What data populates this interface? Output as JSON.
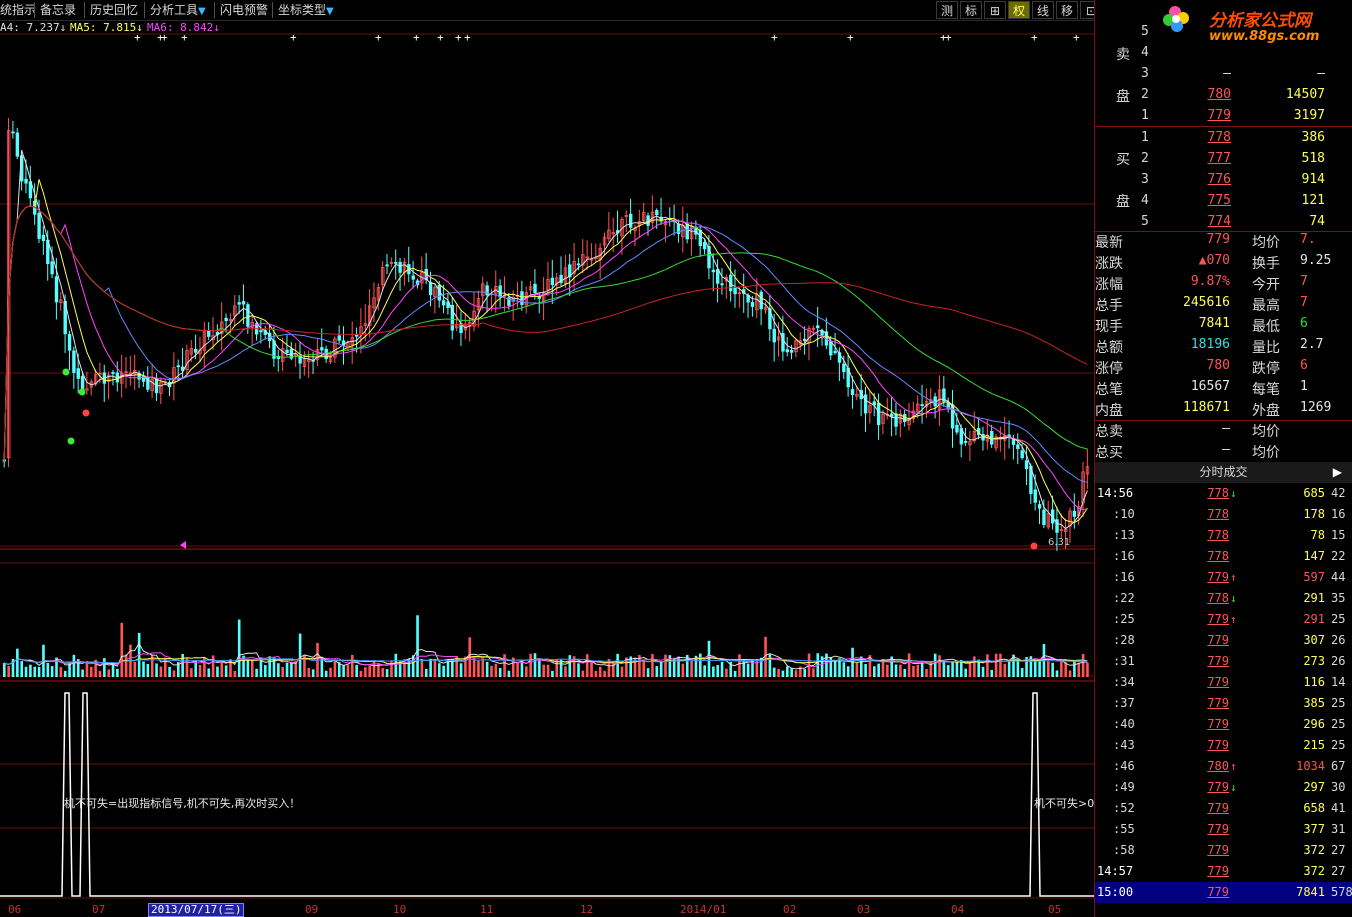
{
  "toolbar": {
    "items": [
      "统指示",
      "备忘录",
      "历史回忆",
      "分析工具",
      "闪电预警",
      "坐标类型"
    ],
    "right_buttons": [
      "测",
      "标",
      "⊞",
      "权",
      "线",
      "移",
      "⊡",
      "⊠"
    ]
  },
  "ma_legend": {
    "ma4": "A4: 7.237↓",
    "ma5": "MA5: 7.815↓",
    "ma6": "MA6: 8.842↓"
  },
  "chart_notes": {
    "low_marker": "6.31",
    "signal_text_left": "机不可失=出现指标信号,机不可失,再次时买入！",
    "signal_text_right": "机不可失>0"
  },
  "x_axis": {
    "labels": [
      "06",
      "07",
      "09",
      "10",
      "11",
      "12",
      "2014/01",
      "02",
      "03",
      "04",
      "05"
    ],
    "selected_date": "2013/07/17(三)"
  },
  "logo": {
    "text": "分析家公式网",
    "url_text": "www.88gs.com"
  },
  "orderbook": {
    "sell_label_1": "卖",
    "sell_label_2": "盘",
    "buy_label_1": "买",
    "buy_label_2": "盘",
    "sell": [
      {
        "level": "5",
        "price": "",
        "volume": ""
      },
      {
        "level": "4",
        "price": "",
        "volume": ""
      },
      {
        "level": "3",
        "price": "–",
        "volume": "–"
      },
      {
        "level": "2",
        "price": "780",
        "volume": "14507"
      },
      {
        "level": "1",
        "price": "779",
        "volume": "3197"
      }
    ],
    "buy": [
      {
        "level": "1",
        "price": "778",
        "volume": "386"
      },
      {
        "level": "2",
        "price": "777",
        "volume": "518"
      },
      {
        "level": "3",
        "price": "776",
        "volume": "914"
      },
      {
        "level": "4",
        "price": "775",
        "volume": "121"
      },
      {
        "level": "5",
        "price": "774",
        "volume": "74"
      }
    ]
  },
  "stats": [
    {
      "l": "最新",
      "v": "779",
      "vc": "red",
      "r": "均价",
      "rv": "7."
    },
    {
      "l": "涨跌",
      "v": "▲070",
      "vc": "red",
      "r": "换手",
      "rv": "9.25"
    },
    {
      "l": "涨幅",
      "v": "9.87%",
      "vc": "red",
      "r": "今开",
      "rv": "7"
    },
    {
      "l": "总手",
      "v": "245616",
      "vc": "yellow",
      "r": "最高",
      "rv": "7"
    },
    {
      "l": "现手",
      "v": "7841",
      "vc": "yellow",
      "r": "最低",
      "rv": "6"
    },
    {
      "l": "总额",
      "v": "18196",
      "vc": "cyan",
      "r": "量比",
      "rv": "2.7"
    },
    {
      "l": "涨停",
      "v": "780",
      "vc": "red",
      "r": "跌停",
      "rv": "6"
    },
    {
      "l": "总笔",
      "v": "16567",
      "vc": "white",
      "r": "每笔",
      "rv": "1"
    },
    {
      "l": "内盘",
      "v": "118671",
      "vc": "yellow",
      "r": "外盘",
      "rv": "1269"
    },
    {
      "l": "总卖",
      "v": "–",
      "vc": "white",
      "r": "均价",
      "rv": ""
    },
    {
      "l": "总买",
      "v": "–",
      "vc": "white",
      "r": "均价",
      "rv": ""
    }
  ],
  "ticks_header": "分时成交",
  "ticks": [
    {
      "t": "14:56",
      "p": "778",
      "pc": "red",
      "ar": "↓",
      "ac": "green",
      "v": "685",
      "vc": "yellow",
      "n": "42"
    },
    {
      "t": ":10",
      "p": "778",
      "pc": "red",
      "ar": "",
      "ac": "",
      "v": "178",
      "vc": "yellow",
      "n": "16"
    },
    {
      "t": ":13",
      "p": "778",
      "pc": "red",
      "ar": "",
      "ac": "",
      "v": "78",
      "vc": "yellow",
      "n": "15"
    },
    {
      "t": ":16",
      "p": "778",
      "pc": "red",
      "ar": "",
      "ac": "",
      "v": "147",
      "vc": "yellow",
      "n": "22"
    },
    {
      "t": ":16",
      "p": "779",
      "pc": "red",
      "ar": "↑",
      "ac": "red",
      "v": "597",
      "vc": "red",
      "n": "44"
    },
    {
      "t": ":22",
      "p": "778",
      "pc": "red",
      "ar": "↓",
      "ac": "green",
      "v": "291",
      "vc": "yellow",
      "n": "35"
    },
    {
      "t": ":25",
      "p": "779",
      "pc": "red",
      "ar": "↑",
      "ac": "red",
      "v": "291",
      "vc": "red",
      "n": "25"
    },
    {
      "t": ":28",
      "p": "779",
      "pc": "red",
      "ar": "",
      "ac": "",
      "v": "307",
      "vc": "yellow",
      "n": "26"
    },
    {
      "t": ":31",
      "p": "779",
      "pc": "red",
      "ar": "",
      "ac": "",
      "v": "273",
      "vc": "yellow",
      "n": "26"
    },
    {
      "t": ":34",
      "p": "779",
      "pc": "red",
      "ar": "",
      "ac": "",
      "v": "116",
      "vc": "yellow",
      "n": "14"
    },
    {
      "t": ":37",
      "p": "779",
      "pc": "red",
      "ar": "",
      "ac": "",
      "v": "385",
      "vc": "yellow",
      "n": "25"
    },
    {
      "t": ":40",
      "p": "779",
      "pc": "red",
      "ar": "",
      "ac": "",
      "v": "296",
      "vc": "yellow",
      "n": "25"
    },
    {
      "t": ":43",
      "p": "779",
      "pc": "red",
      "ar": "",
      "ac": "",
      "v": "215",
      "vc": "yellow",
      "n": "25"
    },
    {
      "t": ":46",
      "p": "780",
      "pc": "red",
      "ar": "↑",
      "ac": "red",
      "v": "1034",
      "vc": "red",
      "n": "67"
    },
    {
      "t": ":49",
      "p": "779",
      "pc": "red",
      "ar": "↓",
      "ac": "green",
      "v": "297",
      "vc": "yellow",
      "n": "30"
    },
    {
      "t": ":52",
      "p": "779",
      "pc": "red",
      "ar": "",
      "ac": "",
      "v": "658",
      "vc": "yellow",
      "n": "41"
    },
    {
      "t": ":55",
      "p": "779",
      "pc": "red",
      "ar": "",
      "ac": "",
      "v": "377",
      "vc": "yellow",
      "n": "31"
    },
    {
      "t": ":58",
      "p": "779",
      "pc": "red",
      "ar": "",
      "ac": "",
      "v": "372",
      "vc": "yellow",
      "n": "27"
    },
    {
      "t": "14:57",
      "p": "779",
      "pc": "red",
      "ar": "",
      "ac": "",
      "v": "372",
      "vc": "yellow",
      "n": "27"
    },
    {
      "t": "15:00",
      "p": "779",
      "pc": "red",
      "ar": "",
      "ac": "",
      "v": "7841",
      "vc": "yellow",
      "n": "578"
    }
  ],
  "colors": {
    "up": "#ff5555",
    "down": "#55ffff",
    "ma_white": "#e0e0e0",
    "ma_yellow": "#ffff55",
    "ma_magenta": "#ff44ff",
    "ma_green": "#33dd33",
    "ma_red": "#cc2222",
    "ma_blue": "#6688ff"
  }
}
